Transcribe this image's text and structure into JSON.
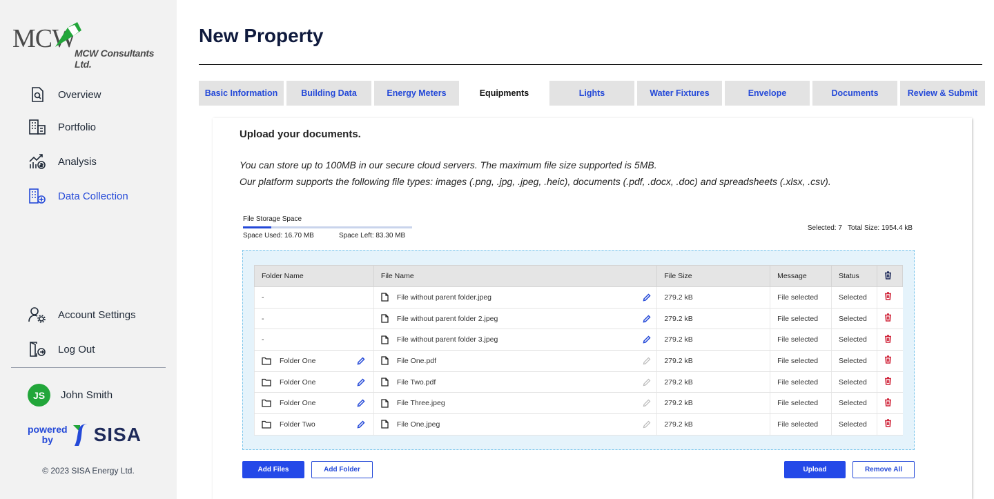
{
  "brand": {
    "logo_mark": "MCW",
    "logo_subtitle": "MCW Consultants Ltd."
  },
  "nav": {
    "overview": "Overview",
    "portfolio": "Portfolio",
    "analysis": "Analysis",
    "data_collection": "Data Collection",
    "account_settings": "Account Settings",
    "log_out": "Log Out"
  },
  "user": {
    "initials": "JS",
    "name": "John Smith"
  },
  "powered": {
    "line1": "powered",
    "line2": "by",
    "brand": "SISA"
  },
  "copyright": "© 2023 SISA Energy Ltd.",
  "colors": {
    "accent": "#2449d8",
    "danger": "#d0253a",
    "avatar": "#22a63a",
    "brand_green": "#22a63a"
  },
  "page": {
    "title": "New Property"
  },
  "tabs": [
    {
      "label": "Basic Information"
    },
    {
      "label": "Building Data"
    },
    {
      "label": "Energy Meters"
    },
    {
      "label": "Equipments",
      "active": true
    },
    {
      "label": "Lights"
    },
    {
      "label": "Water Fixtures"
    },
    {
      "label": "Envelope"
    },
    {
      "label": "Documents"
    },
    {
      "label": "Review & Submit"
    }
  ],
  "upload": {
    "heading": "Upload your documents.",
    "info_1": "You can store up to 100MB in our secure cloud servers. The maximum file size supported is 5MB.",
    "info_2": "Our platform supports the following file types: images (.png, .jpg, .jpeg, .heic), documents (.pdf, .docx, .doc) and spreadsheets (.xlsx, .csv)."
  },
  "storage": {
    "label": "File Storage Space",
    "used_fraction": 0.167,
    "space_used": "Space Used: 16.70 MB",
    "space_left": "Space Left: 83.30 MB",
    "selected_info": "Selected: 7   Total Size: 1954.4 kB"
  },
  "table": {
    "headers": {
      "folder": "Folder Name",
      "file": "File Name",
      "size": "File Size",
      "message": "Message",
      "status": "Status"
    },
    "rows": [
      {
        "folder": "-",
        "file": "File without parent folder.jpeg",
        "size": "279.2 kB",
        "message": "File selected",
        "status": "Selected"
      },
      {
        "folder": "-",
        "file": "File without parent folder 2.jpeg",
        "size": "279.2 kB",
        "message": "File selected",
        "status": "Selected"
      },
      {
        "folder": "-",
        "file": "File without parent folder 3.jpeg",
        "size": "279.2 kB",
        "message": "File selected",
        "status": "Selected"
      },
      {
        "folder": "Folder One",
        "file": "File One.pdf",
        "size": "279.2 kB",
        "message": "File selected",
        "status": "Selected"
      },
      {
        "folder": "Folder One",
        "file": "File Two.pdf",
        "size": "279.2 kB",
        "message": "File selected",
        "status": "Selected"
      },
      {
        "folder": "Folder One",
        "file": "File Three.jpeg",
        "size": "279.2 kB",
        "message": "File selected",
        "status": "Selected"
      },
      {
        "folder": "Folder Two",
        "file": "File One.jpeg",
        "size": "279.2 kB",
        "message": "File selected",
        "status": "Selected"
      }
    ]
  },
  "buttons": {
    "add_files": "Add Files",
    "add_folder": "Add Folder",
    "upload": "Upload",
    "remove_all": "Remove All"
  }
}
